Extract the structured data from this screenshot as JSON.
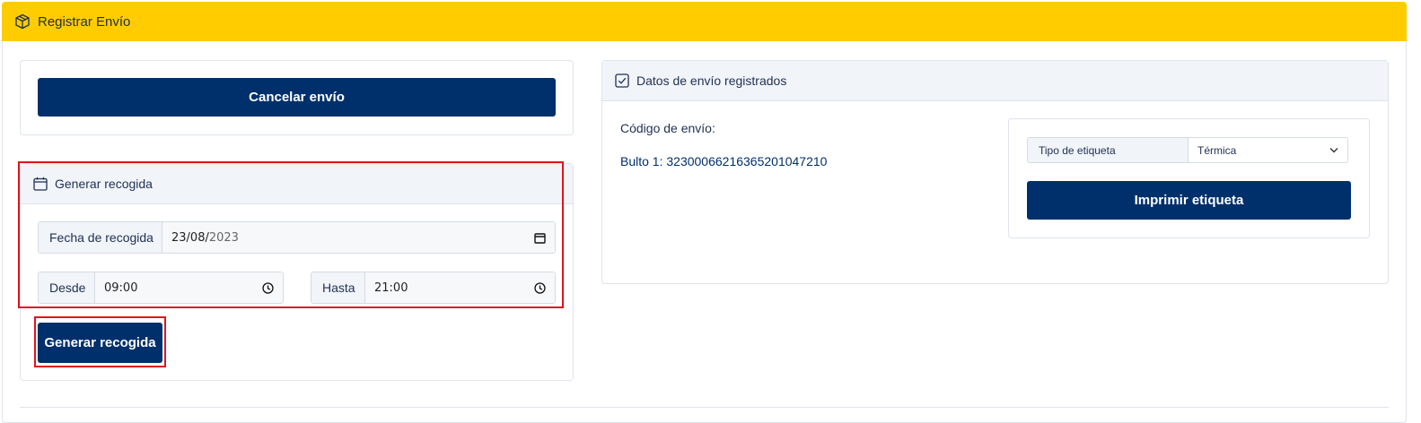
{
  "header": {
    "title": "Registrar Envío",
    "icon": "box-icon",
    "color": "#ffcc00"
  },
  "cancel": {
    "label": "Cancelar envío"
  },
  "pickup": {
    "title": "Generar recogida",
    "icon": "calendar-icon",
    "date": {
      "label": "Fecha de recogida",
      "value_day_month": "23/08/",
      "value_year": "2023"
    },
    "from": {
      "label": "Desde",
      "value": "09:00"
    },
    "to": {
      "label": "Hasta",
      "value": "21:00"
    },
    "button": "Generar recogida"
  },
  "shipment": {
    "title": "Datos de envío registrados",
    "icon": "checkbox-icon",
    "code_label": "Código de envío:",
    "package_line": "Bulto 1: 3230006621636520104721​0",
    "label_type": {
      "label": "Tipo de etiqueta",
      "value": "Térmica"
    },
    "print_button": "Imprimir etiqueta"
  },
  "colors": {
    "primary": "#00306b",
    "highlight": "#e0141b"
  }
}
